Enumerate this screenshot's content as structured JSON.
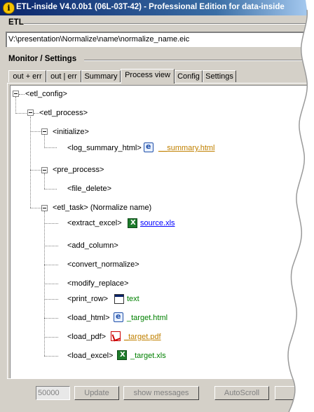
{
  "window": {
    "title": "ETL-inside V4.0.0b1 (06L-03T-42) - Professional Edition  for data-inside"
  },
  "etl_group": {
    "label": "ETL",
    "path": "V:\\presentation\\Normalize\\name\\normalize_name.eic"
  },
  "monitor_group": {
    "label": "Monitor / Settings",
    "tabs": [
      {
        "label": "out + err",
        "active": false
      },
      {
        "label": "out | err",
        "active": false
      },
      {
        "label": "Summary",
        "active": false
      },
      {
        "label": "Process view",
        "active": true
      },
      {
        "label": "Config",
        "active": false
      },
      {
        "label": "Settings",
        "active": false
      }
    ]
  },
  "tree": {
    "etl_config": "<etl_config>",
    "etl_process": "<etl_process>",
    "initialize": "<initialize>",
    "log_summary_html": "<log_summary_html>",
    "log_summary_file": "__summary.html",
    "pre_process": "<pre_process>",
    "file_delete": "<file_delete>",
    "etl_task": "<etl_task> (Normalize name)",
    "extract_excel": "<extract_excel>",
    "extract_file": "source.xls",
    "add_column": "<add_column>",
    "convert_normalize": "<convert_normalize>",
    "modify_replace": "<modify_replace>",
    "print_row": "<print_row>",
    "print_target": "text",
    "load_html": "<load_html>",
    "load_html_file": "_target.html",
    "load_pdf": "<load_pdf>",
    "load_pdf_file": "_target.pdf",
    "load_excel": "<load_excel>",
    "load_excel_file": "_target.xls"
  },
  "bottom_bar": {
    "row_limit": "50000",
    "update_label": "Update",
    "show_messages_label": "show messages",
    "autoscroll_label": "AutoScroll"
  }
}
